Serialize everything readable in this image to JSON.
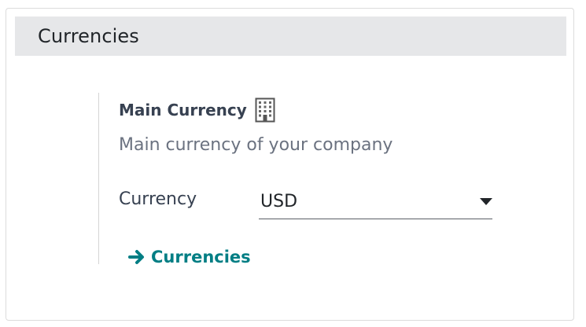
{
  "section": {
    "title": "Currencies"
  },
  "setting": {
    "title": "Main Currency",
    "title_icon": "building-icon",
    "description": "Main currency of your company",
    "field_label": "Currency",
    "field_value": "USD",
    "field_icon": "caret-down-icon",
    "link_icon": "arrow-right-icon",
    "link_label": "Currencies"
  },
  "colors": {
    "header_background": "#e6e7e9",
    "link": "#017e84",
    "muted_text": "#6b7280"
  }
}
